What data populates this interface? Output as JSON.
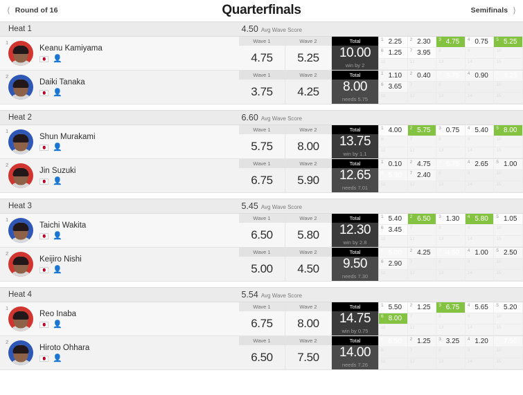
{
  "nav": {
    "prev_label": "Round of 16",
    "prev_icon": "chevron-left-icon",
    "title": "Quarterfinals",
    "next_label": "Semifinals",
    "next_icon": "chevron-right-icon"
  },
  "labels": {
    "wave1": "Wave 1",
    "wave2": "Wave 2",
    "total": "Total",
    "avg_suffix": "Avg Wave Score",
    "flag_icon": "japan-flag-icon",
    "surfer_icon": "surfer-icon"
  },
  "colors": {
    "counted_wave": "#84c341",
    "total_leader_bg": "#3a3a3a",
    "total_other_bg": "#4a4a4a",
    "header_black": "#000000",
    "flag_red": "#bc002d"
  },
  "heats": [
    {
      "name": "Heat 1",
      "avg_wave_score": "4.50",
      "athletes": [
        {
          "seed": "1",
          "name": "Keanu Kamiyama",
          "avatar_color": "#d0352f",
          "wave1": "4.75",
          "wave2": "5.25",
          "total": "10.00",
          "note": "win by 2",
          "leader": true,
          "waves": [
            {
              "n": "1",
              "score": "2.25",
              "counted": false
            },
            {
              "n": "2",
              "score": "2.30",
              "counted": false
            },
            {
              "n": "3",
              "score": "4.75",
              "counted": true
            },
            {
              "n": "4",
              "score": "0.75",
              "counted": false
            },
            {
              "n": "5",
              "score": "5.25",
              "counted": true
            },
            {
              "n": "6",
              "score": "1.25",
              "counted": false
            },
            {
              "n": "7",
              "score": "3.95",
              "counted": false
            },
            {
              "n": "8",
              "score": "",
              "counted": false
            },
            {
              "n": "9",
              "score": "",
              "counted": false
            },
            {
              "n": "10",
              "score": "",
              "counted": false
            },
            {
              "n": "11",
              "score": "",
              "counted": false
            },
            {
              "n": "12",
              "score": "",
              "counted": false
            },
            {
              "n": "13",
              "score": "",
              "counted": false
            },
            {
              "n": "14",
              "score": "",
              "counted": false
            },
            {
              "n": "15",
              "score": "",
              "counted": false
            }
          ]
        },
        {
          "seed": "2",
          "name": "Daiki Tanaka",
          "avatar_color": "#2f57b5",
          "wave1": "3.75",
          "wave2": "4.25",
          "total": "8.00",
          "note": "needs 5.75",
          "leader": false,
          "waves": [
            {
              "n": "1",
              "score": "1.10",
              "counted": false
            },
            {
              "n": "2",
              "score": "0.40",
              "counted": false
            },
            {
              "n": "3",
              "score": "3.75",
              "counted": true
            },
            {
              "n": "4",
              "score": "0.90",
              "counted": false
            },
            {
              "n": "5",
              "score": "4.25",
              "counted": true
            },
            {
              "n": "6",
              "score": "3.65",
              "counted": false
            },
            {
              "n": "7",
              "score": "",
              "counted": false
            },
            {
              "n": "8",
              "score": "",
              "counted": false
            },
            {
              "n": "9",
              "score": "",
              "counted": false
            },
            {
              "n": "10",
              "score": "",
              "counted": false
            },
            {
              "n": "11",
              "score": "",
              "counted": false
            },
            {
              "n": "12",
              "score": "",
              "counted": false
            },
            {
              "n": "13",
              "score": "",
              "counted": false
            },
            {
              "n": "14",
              "score": "",
              "counted": false
            },
            {
              "n": "15",
              "score": "",
              "counted": false
            }
          ]
        }
      ]
    },
    {
      "name": "Heat 2",
      "avg_wave_score": "6.60",
      "athletes": [
        {
          "seed": "1",
          "name": "Shun Murakami",
          "avatar_color": "#2f57b5",
          "wave1": "5.75",
          "wave2": "8.00",
          "total": "13.75",
          "note": "win by 1.1",
          "leader": true,
          "waves": [
            {
              "n": "1",
              "score": "4.00",
              "counted": false
            },
            {
              "n": "2",
              "score": "5.75",
              "counted": true
            },
            {
              "n": "3",
              "score": "0.75",
              "counted": false
            },
            {
              "n": "4",
              "score": "5.40",
              "counted": false
            },
            {
              "n": "5",
              "score": "8.00",
              "counted": true
            },
            {
              "n": "6",
              "score": "",
              "counted": false
            },
            {
              "n": "7",
              "score": "",
              "counted": false
            },
            {
              "n": "8",
              "score": "",
              "counted": false
            },
            {
              "n": "9",
              "score": "",
              "counted": false
            },
            {
              "n": "10",
              "score": "",
              "counted": false
            },
            {
              "n": "11",
              "score": "",
              "counted": false
            },
            {
              "n": "12",
              "score": "",
              "counted": false
            },
            {
              "n": "13",
              "score": "",
              "counted": false
            },
            {
              "n": "14",
              "score": "",
              "counted": false
            },
            {
              "n": "15",
              "score": "",
              "counted": false
            }
          ]
        },
        {
          "seed": "2",
          "name": "Jin Suzuki",
          "avatar_color": "#d0352f",
          "wave1": "6.75",
          "wave2": "5.90",
          "total": "12.65",
          "note": "needs 7.01",
          "leader": false,
          "waves": [
            {
              "n": "1",
              "score": "0.10",
              "counted": false
            },
            {
              "n": "2",
              "score": "4.75",
              "counted": false
            },
            {
              "n": "3",
              "score": "6.75",
              "counted": true
            },
            {
              "n": "4",
              "score": "2.65",
              "counted": false
            },
            {
              "n": "5",
              "score": "1.00",
              "counted": false
            },
            {
              "n": "6",
              "score": "5.90",
              "counted": true
            },
            {
              "n": "7",
              "score": "2.40",
              "counted": false
            },
            {
              "n": "8",
              "score": "",
              "counted": false
            },
            {
              "n": "9",
              "score": "",
              "counted": false
            },
            {
              "n": "10",
              "score": "",
              "counted": false
            },
            {
              "n": "11",
              "score": "",
              "counted": false
            },
            {
              "n": "12",
              "score": "",
              "counted": false
            },
            {
              "n": "13",
              "score": "",
              "counted": false
            },
            {
              "n": "14",
              "score": "",
              "counted": false
            },
            {
              "n": "15",
              "score": "",
              "counted": false
            }
          ]
        }
      ]
    },
    {
      "name": "Heat 3",
      "avg_wave_score": "5.45",
      "athletes": [
        {
          "seed": "1",
          "name": "Taichi Wakita",
          "avatar_color": "#2f57b5",
          "wave1": "6.50",
          "wave2": "5.80",
          "total": "12.30",
          "note": "win by 2.8",
          "leader": true,
          "waves": [
            {
              "n": "1",
              "score": "5.40",
              "counted": false
            },
            {
              "n": "2",
              "score": "6.50",
              "counted": true
            },
            {
              "n": "3",
              "score": "1.30",
              "counted": false
            },
            {
              "n": "4",
              "score": "5.80",
              "counted": true
            },
            {
              "n": "5",
              "score": "1.05",
              "counted": false
            },
            {
              "n": "6",
              "score": "3.45",
              "counted": false
            },
            {
              "n": "7",
              "score": "",
              "counted": false
            },
            {
              "n": "8",
              "score": "",
              "counted": false
            },
            {
              "n": "9",
              "score": "",
              "counted": false
            },
            {
              "n": "10",
              "score": "",
              "counted": false
            },
            {
              "n": "11",
              "score": "",
              "counted": false
            },
            {
              "n": "12",
              "score": "",
              "counted": false
            },
            {
              "n": "13",
              "score": "",
              "counted": false
            },
            {
              "n": "14",
              "score": "",
              "counted": false
            },
            {
              "n": "15",
              "score": "",
              "counted": false
            }
          ]
        },
        {
          "seed": "2",
          "name": "Keijiro Nishi",
          "avatar_color": "#d0352f",
          "wave1": "5.00",
          "wave2": "4.50",
          "total": "9.50",
          "note": "needs 7.30",
          "leader": false,
          "waves": [
            {
              "n": "1",
              "score": "5.00",
              "counted": true
            },
            {
              "n": "2",
              "score": "4.25",
              "counted": false
            },
            {
              "n": "3",
              "score": "4.50",
              "counted": true
            },
            {
              "n": "4",
              "score": "1.00",
              "counted": false
            },
            {
              "n": "5",
              "score": "2.50",
              "counted": false
            },
            {
              "n": "6",
              "score": "2.90",
              "counted": false
            },
            {
              "n": "7",
              "score": "",
              "counted": false
            },
            {
              "n": "8",
              "score": "",
              "counted": false
            },
            {
              "n": "9",
              "score": "",
              "counted": false
            },
            {
              "n": "10",
              "score": "",
              "counted": false
            },
            {
              "n": "11",
              "score": "",
              "counted": false
            },
            {
              "n": "12",
              "score": "",
              "counted": false
            },
            {
              "n": "13",
              "score": "",
              "counted": false
            },
            {
              "n": "14",
              "score": "",
              "counted": false
            },
            {
              "n": "15",
              "score": "",
              "counted": false
            }
          ]
        }
      ]
    },
    {
      "name": "Heat 4",
      "avg_wave_score": "5.54",
      "athletes": [
        {
          "seed": "1",
          "name": "Reo Inaba",
          "avatar_color": "#d0352f",
          "wave1": "6.75",
          "wave2": "8.00",
          "total": "14.75",
          "note": "win by 0.75",
          "leader": true,
          "waves": [
            {
              "n": "1",
              "score": "5.50",
              "counted": false
            },
            {
              "n": "2",
              "score": "1.25",
              "counted": false
            },
            {
              "n": "3",
              "score": "6.75",
              "counted": true
            },
            {
              "n": "4",
              "score": "5.65",
              "counted": false
            },
            {
              "n": "5",
              "score": "5.20",
              "counted": false
            },
            {
              "n": "6",
              "score": "8.00",
              "counted": true
            },
            {
              "n": "7",
              "score": "",
              "counted": false
            },
            {
              "n": "8",
              "score": "",
              "counted": false
            },
            {
              "n": "9",
              "score": "",
              "counted": false
            },
            {
              "n": "10",
              "score": "",
              "counted": false
            },
            {
              "n": "11",
              "score": "",
              "counted": false
            },
            {
              "n": "12",
              "score": "",
              "counted": false
            },
            {
              "n": "13",
              "score": "",
              "counted": false
            },
            {
              "n": "14",
              "score": "",
              "counted": false
            },
            {
              "n": "15",
              "score": "",
              "counted": false
            }
          ]
        },
        {
          "seed": "2",
          "name": "Hiroto Ohhara",
          "avatar_color": "#2f57b5",
          "wave1": "6.50",
          "wave2": "7.50",
          "total": "14.00",
          "note": "needs 7.26",
          "leader": false,
          "waves": [
            {
              "n": "1",
              "score": "6.50",
              "counted": true
            },
            {
              "n": "2",
              "score": "1.25",
              "counted": false
            },
            {
              "n": "3",
              "score": "3.25",
              "counted": false
            },
            {
              "n": "4",
              "score": "1.20",
              "counted": false
            },
            {
              "n": "5",
              "score": "7.50",
              "counted": true
            },
            {
              "n": "6",
              "score": "",
              "counted": false
            },
            {
              "n": "7",
              "score": "",
              "counted": false
            },
            {
              "n": "8",
              "score": "",
              "counted": false
            },
            {
              "n": "9",
              "score": "",
              "counted": false
            },
            {
              "n": "10",
              "score": "",
              "counted": false
            },
            {
              "n": "11",
              "score": "",
              "counted": false
            },
            {
              "n": "12",
              "score": "",
              "counted": false
            },
            {
              "n": "13",
              "score": "",
              "counted": false
            },
            {
              "n": "14",
              "score": "",
              "counted": false
            },
            {
              "n": "15",
              "score": "",
              "counted": false
            }
          ]
        }
      ]
    }
  ]
}
